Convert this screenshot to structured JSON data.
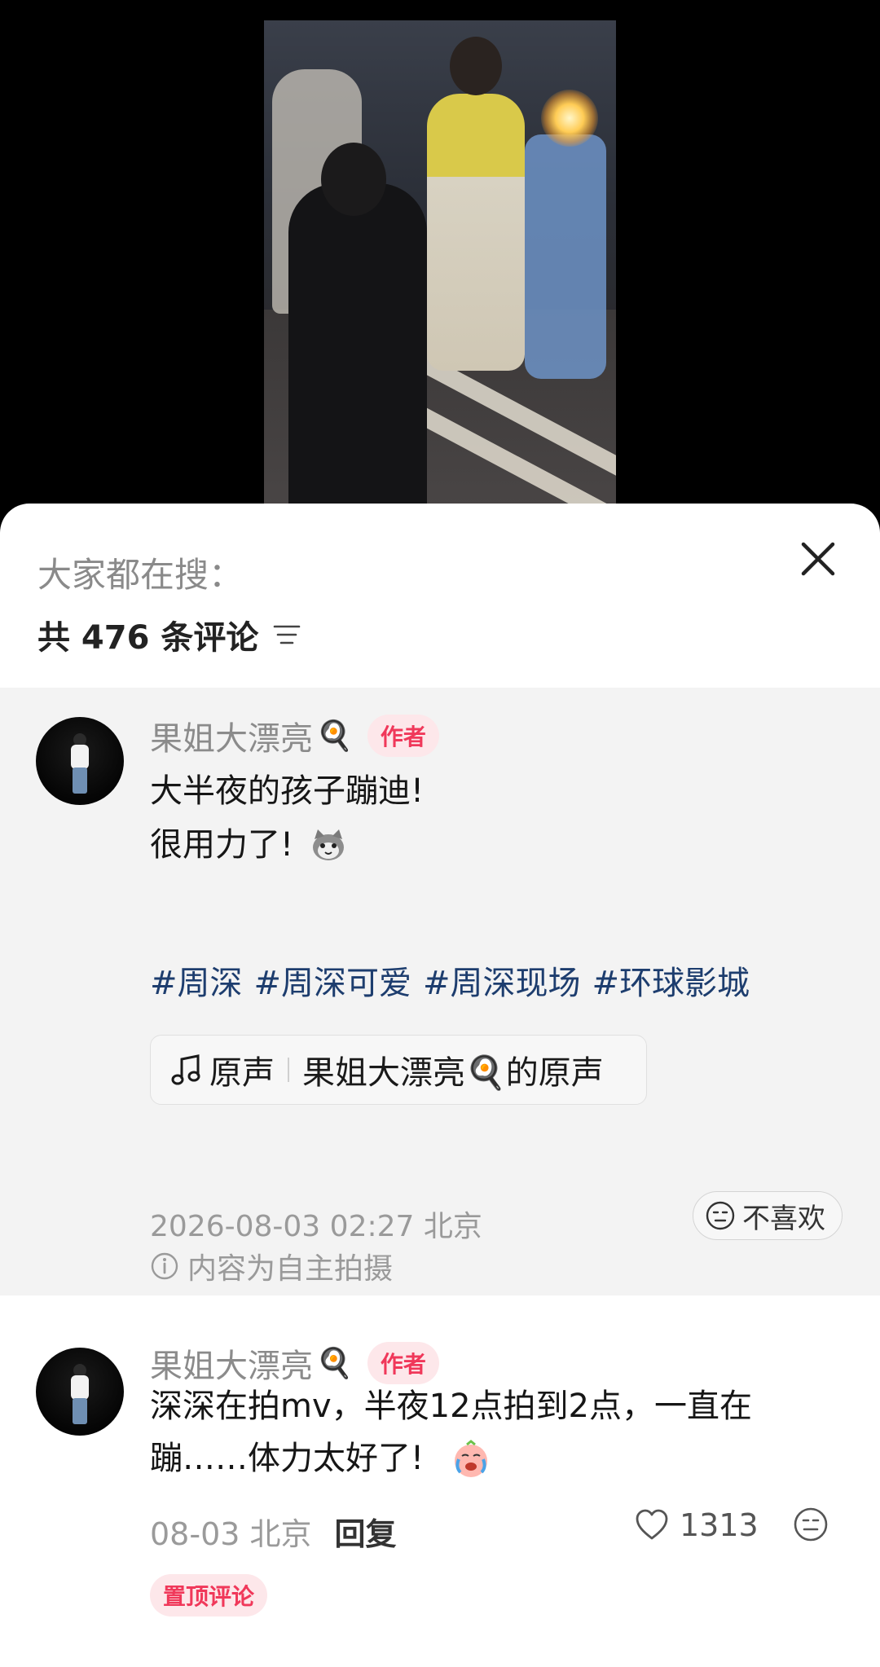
{
  "sheet": {
    "search_hint": "大家都在搜：",
    "comment_count": "共 476 条评论"
  },
  "post": {
    "username": "果姐大漂亮",
    "emoji": "🍳",
    "author_badge": "作者",
    "text_line1": "大半夜的孩子蹦迪!",
    "text_line2": "很用力了!",
    "hashtags": [
      "#周深",
      "#周深可爱",
      "#周深现场",
      "#环球影城"
    ],
    "music_label": "原声",
    "music_title": "果姐大漂亮🍳的原声",
    "timestamp": "2026-08-03 02:27 北京",
    "info": "内容为自主拍摄",
    "dislike_label": "不喜欢"
  },
  "comment": {
    "username": "果姐大漂亮",
    "emoji": "🍳",
    "author_badge": "作者",
    "text": "深深在拍mv，半夜12点拍到2点，一直在蹦……体力太好了!",
    "date": "08-03 北京",
    "reply_label": "回复",
    "likes": "1313",
    "pinned_badge": "置顶评论"
  },
  "colors": {
    "accent_red": "#f0385a",
    "hashtag_blue": "#1d3d6e",
    "post_bg": "#f3f3f3"
  }
}
